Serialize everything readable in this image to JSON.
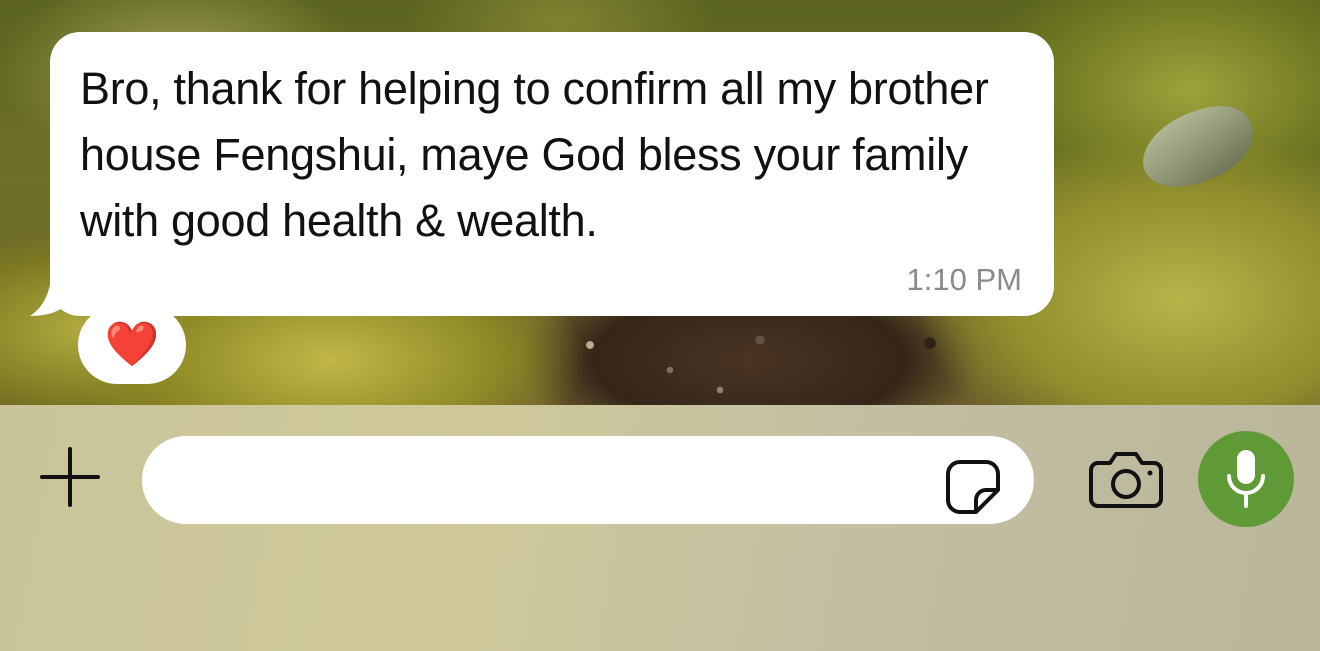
{
  "chat": {
    "message": {
      "text": "Bro, thank for helping to confirm all my brother house Fengshui, maye God bless your family with good health & wealth.",
      "time": "1:10 PM",
      "reaction": "❤️"
    }
  },
  "composer": {
    "input_value": "",
    "input_placeholder": ""
  },
  "icons": {
    "plus": "plus-icon",
    "sticker": "sticker-icon",
    "camera": "camera-icon",
    "microphone": "microphone-icon"
  },
  "colors": {
    "bubble": "#ffffff",
    "mic_button": "#5f9a36",
    "reaction_heart": "#e3202a"
  }
}
